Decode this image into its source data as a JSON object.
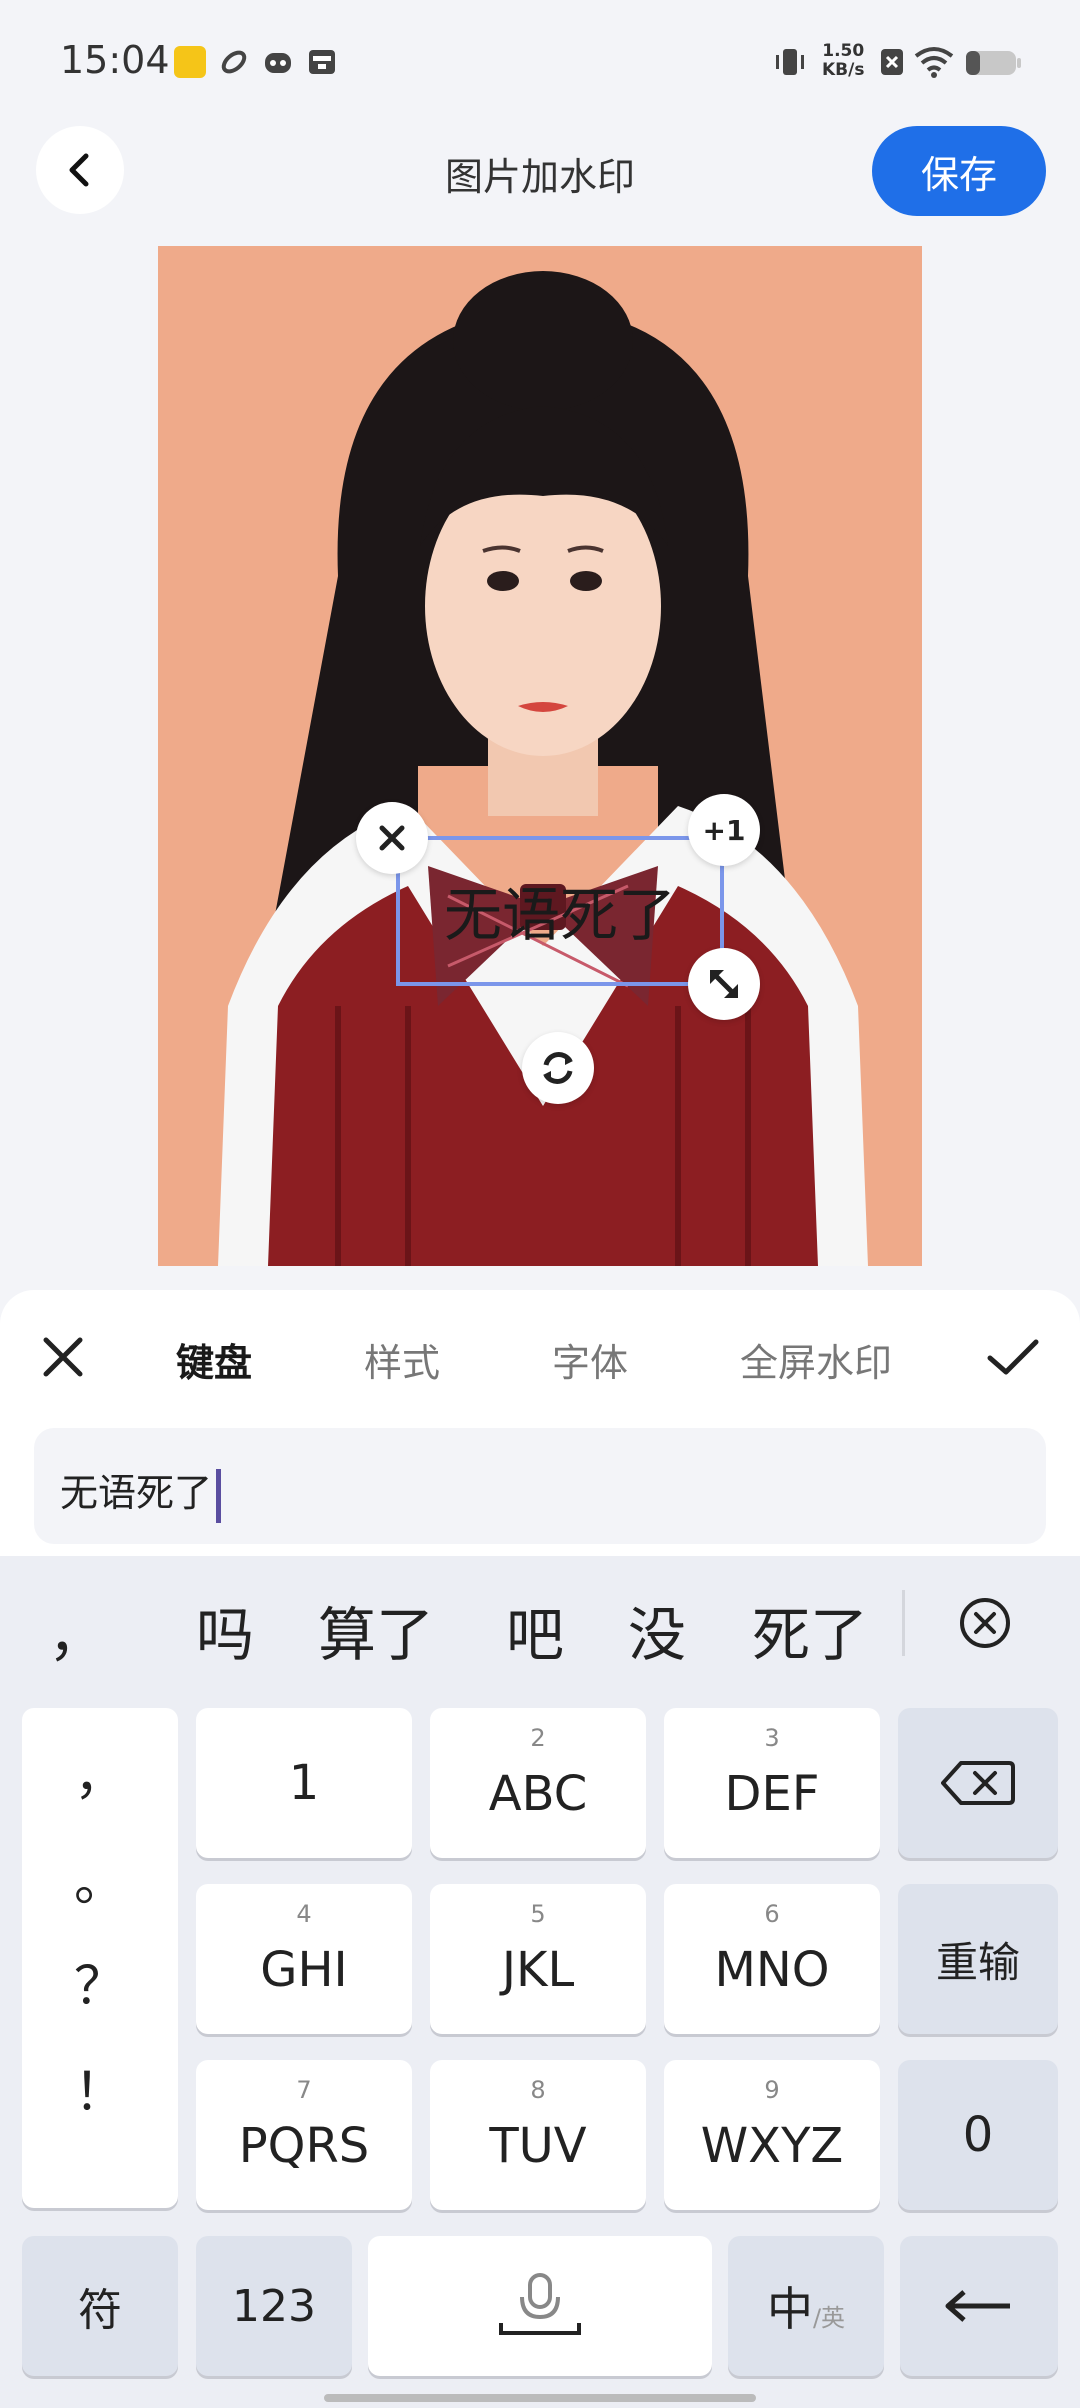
{
  "status_bar": {
    "time": "15:04",
    "net_speed_value": "1.50",
    "net_speed_unit": "KB/s",
    "icons": [
      "app-notification-icon",
      "link-icon",
      "mascot-icon",
      "wallet-icon",
      "vibrate-icon",
      "sim-off-icon",
      "wifi-icon",
      "battery-icon"
    ]
  },
  "header": {
    "title": "图片加水印",
    "save_label": "保存"
  },
  "watermark": {
    "text": "无语死了",
    "plus_badge": "+1"
  },
  "panel": {
    "tabs": [
      "键盘",
      "样式",
      "字体",
      "全屏水印"
    ],
    "active_tab": "键盘",
    "input_value": "无语死了"
  },
  "keyboard": {
    "candidates": [
      "，",
      "吗",
      "算了",
      "吧",
      "没",
      "死了"
    ],
    "punctuation": [
      "，",
      "。",
      "？",
      "！"
    ],
    "keys": {
      "k1": {
        "main": "1",
        "sub": ""
      },
      "k2": {
        "main": "ABC",
        "sub": "2"
      },
      "k3": {
        "main": "DEF",
        "sub": "3"
      },
      "k4": {
        "main": "GHI",
        "sub": "4"
      },
      "k5": {
        "main": "JKL",
        "sub": "5"
      },
      "k6": {
        "main": "MNO",
        "sub": "6"
      },
      "k7": {
        "main": "PQRS",
        "sub": "7"
      },
      "k8": {
        "main": "TUV",
        "sub": "8"
      },
      "k9": {
        "main": "WXYZ",
        "sub": "9"
      },
      "k0": {
        "main": "0",
        "sub": ""
      }
    },
    "reenter_label": "重输",
    "symbol_label": "符",
    "numeric_label": "123",
    "lang_main": "中",
    "lang_sub": "/英"
  },
  "colors": {
    "accent": "#1f6fe8",
    "selection_border": "#7b96ea",
    "photo_bg": "#efaa8a",
    "caret": "#5a4ea0"
  }
}
